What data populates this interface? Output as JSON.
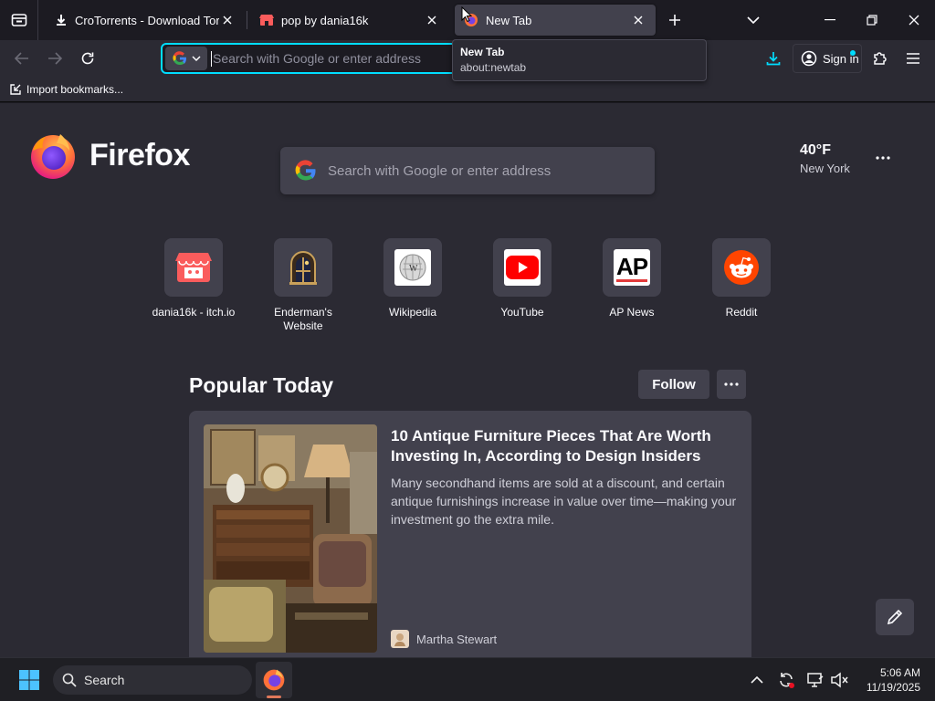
{
  "tabs": [
    {
      "title": "CroTorrents - Download Torrent",
      "icon": "download-arrow-icon"
    },
    {
      "title": "pop by dania16k",
      "icon": "itch-io-icon"
    },
    {
      "title": "New Tab",
      "icon": "firefox-icon",
      "active": true
    }
  ],
  "tab_popup": {
    "title": "New Tab",
    "url": "about:newtab"
  },
  "urlbar": {
    "placeholder": "Search with Google or enter address"
  },
  "signin": {
    "label": "Sign in"
  },
  "bookmarks": {
    "import_label": "Import bookmarks..."
  },
  "newtab": {
    "brand": "Firefox",
    "search_placeholder": "Search with Google or enter address",
    "weather": {
      "temp": "40°F",
      "city": "New York"
    },
    "shortcuts": [
      {
        "label": "dania16k - itch.io",
        "icon": "itch-io-icon"
      },
      {
        "label": "Enderman's Website",
        "icon": "castle-window-icon"
      },
      {
        "label": "Wikipedia",
        "icon": "wikipedia-icon"
      },
      {
        "label": "YouTube",
        "icon": "youtube-icon"
      },
      {
        "label": "AP News",
        "icon": "ap-news-icon",
        "icon_text": "AP"
      },
      {
        "label": "Reddit",
        "icon": "reddit-icon"
      }
    ],
    "popular": {
      "title": "Popular Today",
      "follow_label": "Follow",
      "article": {
        "title": "10 Antique Furniture Pieces That Are Worth Investing In, According to Design Insiders",
        "description": "Many secondhand items are sold at a discount, and certain antique furnishings increase in value over time—making your investment go the extra mile.",
        "source": "Martha Stewart"
      }
    }
  },
  "taskbar": {
    "search_label": "Search",
    "time": "5:06 AM",
    "date": "11/19/2025"
  },
  "colors": {
    "accent": "#00ddff",
    "background": "#2b2a33",
    "card": "#42414d"
  }
}
